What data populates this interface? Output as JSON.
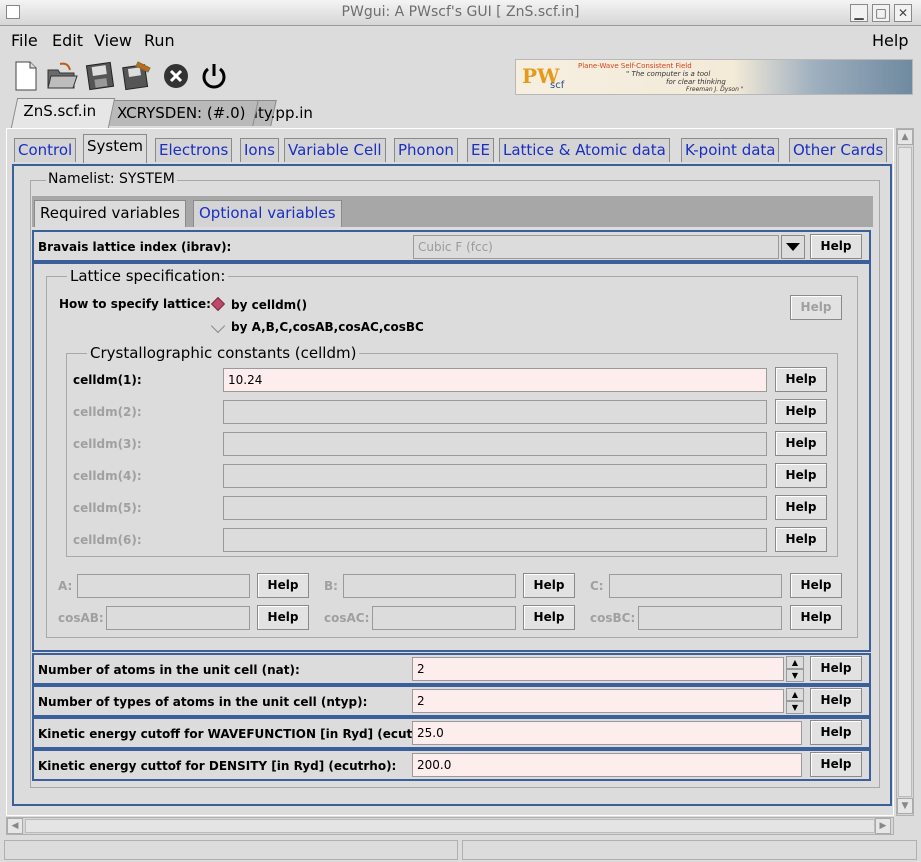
{
  "window": {
    "title": "PWgui: A PWscf's GUI  [ ZnS.scf.in]",
    "min": "▁",
    "max": "□",
    "close": "✕"
  },
  "menu": {
    "file": "File",
    "edit": "Edit",
    "view": "View",
    "run": "Run",
    "help": "Help"
  },
  "logo": {
    "pw": "PW",
    "scf": "scf",
    "line1": "Plane-Wave Self-Consistent Field",
    "line2": "\" The computer is a tool",
    "line3": "for clear thinking",
    "line4": "Freeman J. Dyson \""
  },
  "file_tabs": [
    "ZnS.scf.in",
    "XCRYSDEN: (#.0)",
    "ZnS_density.pp.in"
  ],
  "section_tabs": [
    "Control",
    "System",
    "Electrons",
    "Ions",
    "Variable Cell",
    "Phonon",
    "EE",
    "Lattice & Atomic data",
    "K-point data",
    "Other Cards"
  ],
  "namelist": "Namelist: SYSTEM",
  "subtabs": [
    "Required variables",
    "Optional variables"
  ],
  "help_label": "Help",
  "ibrav": {
    "label": "Bravais lattice index (ibrav):",
    "value": "Cubic F (fcc)"
  },
  "lattice": {
    "legend": "Lattice specification:",
    "how_label": "How to specify lattice:",
    "opt1": "by celldm()",
    "opt2": "by A,B,C,cosAB,cosAC,cosBC",
    "selected": "by celldm()"
  },
  "celldm": {
    "legend": "Crystallographic constants (celldm)",
    "rows": [
      {
        "label": "celldm(1):",
        "value": "10.24"
      },
      {
        "label": "celldm(2):",
        "value": ""
      },
      {
        "label": "celldm(3):",
        "value": ""
      },
      {
        "label": "celldm(4):",
        "value": ""
      },
      {
        "label": "celldm(5):",
        "value": ""
      },
      {
        "label": "celldm(6):",
        "value": ""
      }
    ]
  },
  "abc": {
    "a": "A:",
    "b": "B:",
    "c": "C:",
    "cosab": "cosAB:",
    "cosac": "cosAC:",
    "cosbc": "cosBC:"
  },
  "nat": {
    "label": "Number of atoms in the unit cell (nat):",
    "value": "2"
  },
  "ntyp": {
    "label": "Number of types of atoms in the unit cell (ntyp):",
    "value": "2"
  },
  "ecutwfc": {
    "label": "Kinetic energy cutoff for WAVEFUNCTION [in Ryd] (ecutwfc):",
    "value": "25.0"
  },
  "ecutrho": {
    "label": "Kinetic energy cuttof for DENSITY [in Ryd] (ecutrho):",
    "value": "200.0"
  },
  "colors": {
    "accent": "#3b5f9b",
    "tab_link": "#1a2fc2",
    "entry_bg": "#fdeeed",
    "radio_selected": "#c0466a"
  }
}
